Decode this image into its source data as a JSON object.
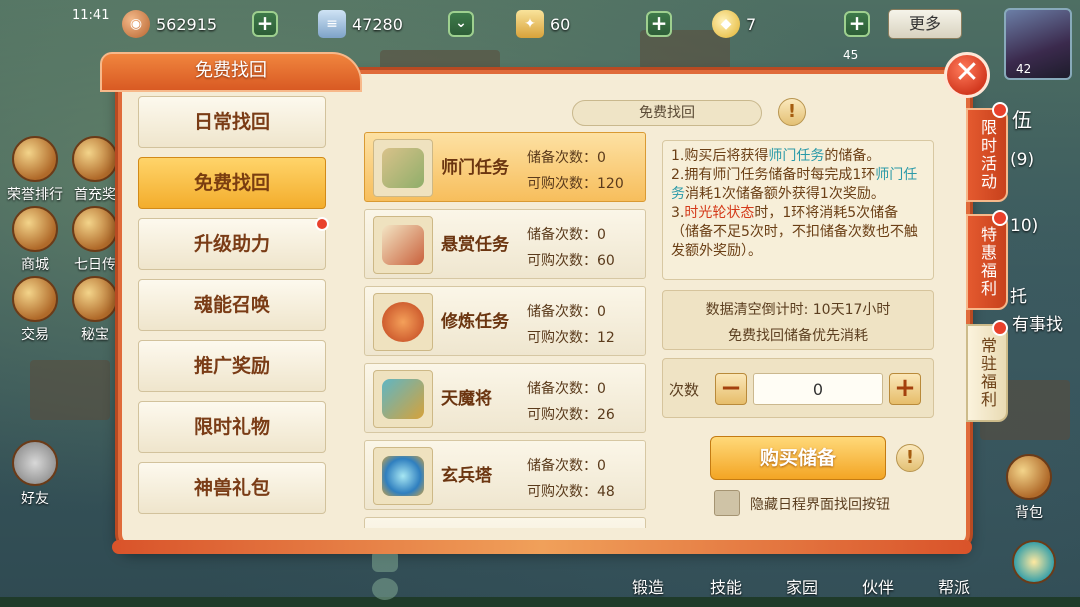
{
  "status": {
    "time": "11:41"
  },
  "resources": [
    {
      "icon": "copper-coin-icon",
      "value": "562915"
    },
    {
      "icon": "scroll-currency-icon",
      "value": "47280"
    },
    {
      "icon": "token-icon",
      "value": "60"
    },
    {
      "icon": "gold-ingot-icon",
      "value": "7"
    }
  ],
  "topbar": {
    "more_label": "更多",
    "portrait_level": "42",
    "mini_level": "45"
  },
  "side_icons": {
    "honor_rank": "荣誉排行",
    "first_charge": "首充奖",
    "shop": "商城",
    "seven_day": "七日传",
    "trade": "交易",
    "treasure": "秘宝",
    "friends": "好友",
    "backpack": "背包"
  },
  "dialog": {
    "title": "免费找回",
    "section_title": "免费找回",
    "nav": [
      {
        "label": "日常找回",
        "active": false,
        "dot": false
      },
      {
        "label": "免费找回",
        "active": true,
        "dot": false
      },
      {
        "label": "升级助力",
        "active": false,
        "dot": true
      },
      {
        "label": "魂能召唤",
        "active": false,
        "dot": false
      },
      {
        "label": "推广奖励",
        "active": false,
        "dot": false
      },
      {
        "label": "限时礼物",
        "active": false,
        "dot": false
      },
      {
        "label": "神兽礼包",
        "active": false,
        "dot": false
      }
    ],
    "tasks": [
      {
        "name": "师门任务",
        "stored_label": "储备次数：",
        "stored": "0",
        "buyable_label": "可购次数：",
        "buyable": "120",
        "active": true,
        "icon": "scroll-icon"
      },
      {
        "name": "悬赏任务",
        "stored_label": "储备次数：",
        "stored": "0",
        "buyable_label": "可购次数：",
        "buyable": "60",
        "active": false,
        "icon": "bounty-scroll-icon"
      },
      {
        "name": "修炼任务",
        "stored_label": "储备次数：",
        "stored": "0",
        "buyable_label": "可购次数：",
        "buyable": "12",
        "active": false,
        "icon": "training-medal-icon"
      },
      {
        "name": "天魔将",
        "stored_label": "储备次数：",
        "stored": "0",
        "buyable_label": "可购次数：",
        "buyable": "26",
        "active": false,
        "icon": "demon-helmet-icon"
      },
      {
        "name": "玄兵塔",
        "stored_label": "储备次数：",
        "stored": "0",
        "buyable_label": "可购次数：",
        "buyable": "48",
        "active": false,
        "icon": "portal-tower-icon"
      }
    ],
    "desc": {
      "p1a": "1.购买后将获得",
      "p1b": "师门任务",
      "p1c": "的储备。",
      "p2a": "2.拥有师门任务储备时每完成1环",
      "p2b": "师门任务",
      "p2c": "消耗1次储备额外获得1次奖励。",
      "p3a": "3.",
      "p3b": "时光轮状态",
      "p3c": "时，1环将消耗5次储备（储备不足5次时，不扣储备次数也不触发额外奖励）。"
    },
    "countdown": "数据清空倒计时: 10天17小时",
    "priority_note": "免费找回储备优先消耗",
    "qty_label": "次数",
    "qty_value": "0",
    "buy_label": "购买储备",
    "hide_label": "隐藏日程界面找回按钮"
  },
  "vtabs": [
    {
      "label": "限时活动"
    },
    {
      "label": "特惠福利"
    },
    {
      "label": "常驻福利"
    }
  ],
  "right_bg": {
    "t1": "伍",
    "t2": "(9)",
    "t3": "10)",
    "t4": "托",
    "t5": "有事找"
  },
  "bottom_bar": [
    "锻造",
    "技能",
    "家园",
    "伙伴",
    "帮派"
  ],
  "colors": {
    "accent": "#e06b3a",
    "active_tab": "#f3ad2c",
    "highlight_blue": "#2b9aa8",
    "highlight_red": "#d43a1a"
  }
}
